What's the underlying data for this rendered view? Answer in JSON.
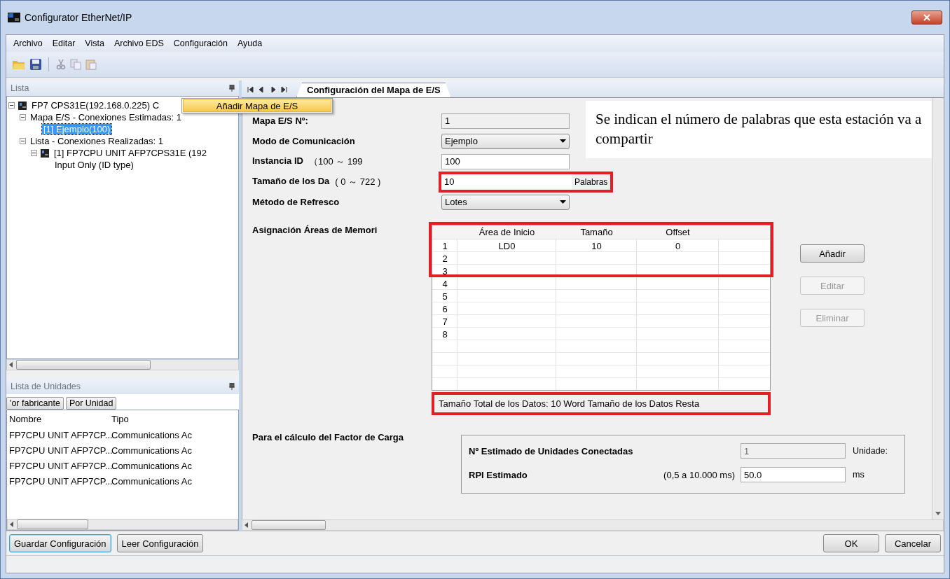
{
  "window": {
    "title": "Configurator EtherNet/IP"
  },
  "menu": [
    {
      "label": "Archivo"
    },
    {
      "label": "Editar"
    },
    {
      "label": "Vista"
    },
    {
      "label": "Archivo EDS"
    },
    {
      "label": "Configuración"
    },
    {
      "label": "Ayuda"
    }
  ],
  "list_panel": {
    "title": "Lista",
    "tree": [
      {
        "label": "FP7 CPS31E(192.168.0.225)  C",
        "kind": "device",
        "selected": false,
        "expanded": true,
        "children": [
          {
            "label": "Mapa E/S - Conexiones Estimadas: 1",
            "selected": false,
            "expanded": true,
            "children": [
              {
                "label": "[1]  Ejemplo(100)",
                "selected": true
              }
            ]
          },
          {
            "label": "Lista - Conexiones Realizadas: 1",
            "selected": false,
            "expanded": true,
            "children": [
              {
                "label": "[1]  FP7CPU UNIT AFP7CPS31E (192",
                "kind": "device",
                "selected": false,
                "expanded": true,
                "children": [
                  {
                    "label": "Input Only (ID type)",
                    "selected": false
                  }
                ]
              }
            ]
          }
        ]
      }
    ]
  },
  "context_menu": {
    "items": [
      {
        "label": "Añadir Mapa de E/S",
        "selected": true
      }
    ]
  },
  "tabs": [
    {
      "label": "Configuración del Mapa de E/S",
      "selected": true
    }
  ],
  "form": {
    "fields": [
      {
        "kind": "readonly",
        "label": "Mapa E/S Nº:",
        "value": "1"
      },
      {
        "kind": "select",
        "label": "Modo de Comunicación",
        "value": "Ejemplo"
      },
      {
        "kind": "text",
        "label": "Instancia ID",
        "range": "（100 ～ 199",
        "value": "100"
      },
      {
        "kind": "unit",
        "label": "Tamaño de los Da",
        "range": "( 0 ～ 722 )",
        "value": "10",
        "unit": "Palabras",
        "highlighted": true
      },
      {
        "kind": "select",
        "label": "Método de Refresco",
        "value": "Lotes"
      }
    ]
  },
  "note": "Se indican el número de palabras que esta estación va a compartir",
  "memory": {
    "label": "Asignación Áreas de Memori",
    "columns": [
      "Área de Inicio",
      "Tamaño",
      "Offset"
    ],
    "rows": [
      {
        "number": "1",
        "cells": [
          "LD0",
          "10",
          "0"
        ]
      },
      {
        "number": "2",
        "cells": []
      },
      {
        "number": "3",
        "cells": []
      },
      {
        "number": "4",
        "cells": []
      },
      {
        "number": "5",
        "cells": []
      },
      {
        "number": "6",
        "cells": []
      },
      {
        "number": "7",
        "cells": []
      },
      {
        "number": "8",
        "cells": []
      }
    ],
    "buttons": [
      {
        "label": "Añadir",
        "disabled": false
      },
      {
        "label": "Editar",
        "disabled": true
      },
      {
        "label": "Eliminar",
        "disabled": true
      }
    ],
    "summary": "Tamaño Total de los Datos: 10 Word   Tamaño de los Datos Resta"
  },
  "load_factor": {
    "label": "Para el cálculo del Factor de Carga",
    "rows": [
      {
        "label": "Nº Estimado de Unidades Conectadas",
        "value": "1",
        "readonly": true,
        "unit": "Unidade:"
      },
      {
        "label": "RPI Estimado",
        "range": "(0,5 a 10.000 ms)",
        "value": "50.0",
        "readonly": false,
        "unit": "ms"
      }
    ]
  },
  "units_panel": {
    "title": "Lista de Unidades",
    "filters": [
      {
        "label": "'or fabricante",
        "selected": false
      },
      {
        "label": "Por Unidad",
        "selected": false
      }
    ],
    "columns": [
      "Nombre",
      "Tipo"
    ],
    "rows": [
      [
        "FP7CPU UNIT AFP7CP...",
        "Communications Ac"
      ],
      [
        "FP7CPU UNIT AFP7CP...",
        "Communications Ac"
      ],
      [
        "FP7CPU UNIT AFP7CP...",
        "Communications Ac"
      ],
      [
        "FP7CPU UNIT AFP7CP...",
        "Communications Ac"
      ]
    ]
  },
  "bottom_buttons": [
    {
      "label": "Guardar Configuración",
      "focused": true
    },
    {
      "label": "Leer Configuración",
      "focused": false
    }
  ],
  "dialog_buttons": [
    {
      "label": "OK"
    },
    {
      "label": "Cancelar"
    }
  ]
}
